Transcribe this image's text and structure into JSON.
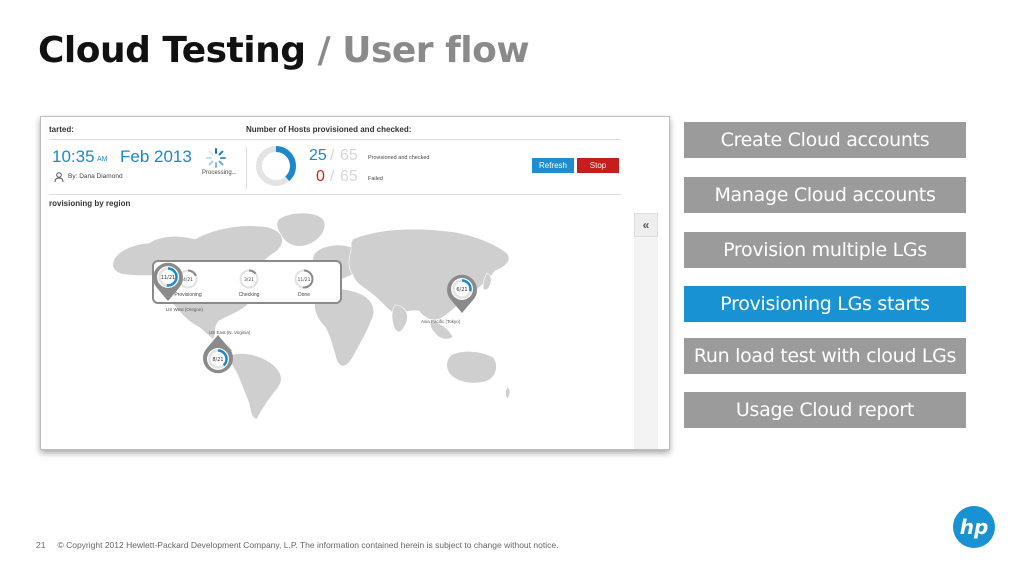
{
  "title": {
    "main": "Cloud Testing",
    "sep": " / ",
    "sub": "User flow"
  },
  "panel": {
    "started_label": "tarted:",
    "hosts_label": "Number of Hosts provisioned and checked:",
    "time": "10:35",
    "ampm": "AM",
    "date": "Feb 2013",
    "by": "By: Dana Diamond",
    "processing": "Processing...",
    "provisioned_count": "25",
    "failed_count": "0",
    "total": "65",
    "provisioned_label": "Provisioned and checked",
    "failed_label": "Failed",
    "refresh_label": "Refresh",
    "stop_label": "Stop",
    "region_label": "rovisioning by region",
    "collapse_glyph": "«",
    "provisioned_fraction": 0.385
  },
  "popup": {
    "stages": [
      {
        "value": "4/21",
        "label": "Provisioning",
        "fraction": 0.19
      },
      {
        "value": "3/21",
        "label": "Checking",
        "fraction": 0.14
      },
      {
        "value": "11/21",
        "label": "Done",
        "fraction": 0.52
      }
    ]
  },
  "pins": [
    {
      "value": "11/21",
      "label": "US West (Oregon)",
      "fraction": 0.52
    },
    {
      "value": "6/21",
      "label": "Asia Pacific (Tokyo)",
      "fraction": 0.29
    },
    {
      "value": "8/21",
      "label": "US East (N. Virginia)",
      "fraction": 0.38
    }
  ],
  "steps": [
    "Create Cloud accounts",
    "Manage Cloud accounts",
    "Provision multiple LGs",
    "Provisioning LGs starts",
    "Run load test with cloud LGs",
    "Usage Cloud report"
  ],
  "footer": {
    "page": "21",
    "copyright": "© Copyright 2012 Hewlett-Packard Development Company, L.P.  The information contained herein is subject to change without notice."
  },
  "logo": {
    "text": "hp"
  },
  "colors": {
    "accent": "#1992d4",
    "step_gray": "#9b9b9b",
    "stop_red": "#c61d1d",
    "map_gray": "#cfcfcf"
  }
}
